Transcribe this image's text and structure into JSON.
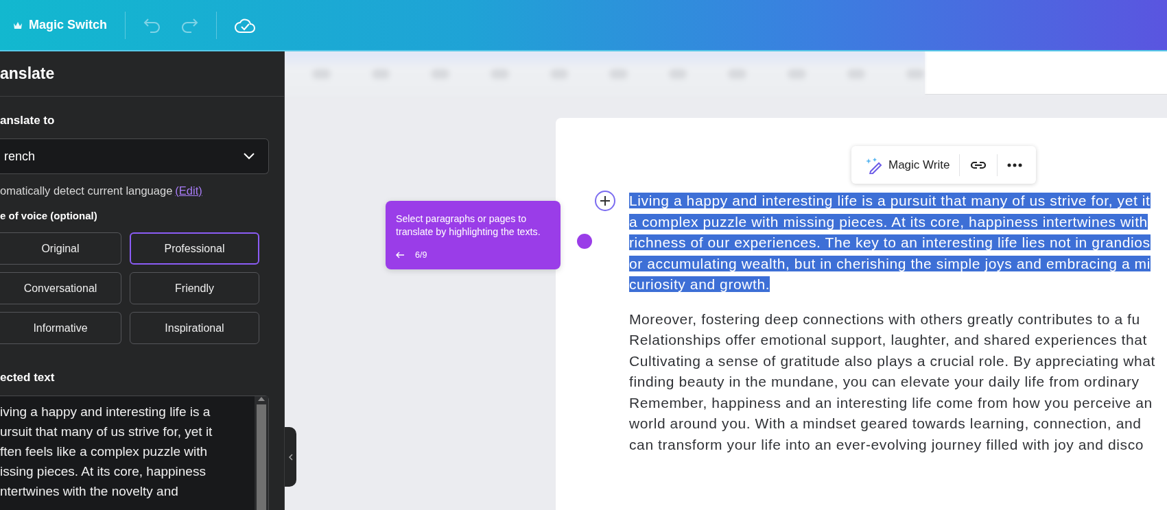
{
  "topbar": {
    "title": "Magic Switch"
  },
  "panel": {
    "title": "anslate",
    "translate_to_label": "anslate to",
    "language": "rench",
    "detect_text": "omatically detect current language",
    "edit_link": "(Edit)",
    "tone_label": "e of voice (optional)",
    "tones": [
      {
        "label": "Original",
        "selected": false
      },
      {
        "label": "Professional",
        "selected": true
      },
      {
        "label": "Conversational",
        "selected": false
      },
      {
        "label": "Friendly",
        "selected": false
      },
      {
        "label": "Informative",
        "selected": false
      },
      {
        "label": "Inspirational",
        "selected": false
      }
    ],
    "selected_text_label": "ected text",
    "selected_text_lines": [
      "iving a happy and interesting life is a",
      "ursuit that many of us strive for, yet it",
      "ften feels like a complex puzzle with",
      "issing pieces. At its core, happiness",
      "ntertwines with the novelty and"
    ]
  },
  "tooltip": {
    "text": "Select paragraphs or pages to translate by highlighting the texts.",
    "step": "6/9"
  },
  "text_toolbar": {
    "label": "Magic Write"
  },
  "document": {
    "paragraphs": [
      {
        "highlighted": true,
        "lines": [
          "Living a happy and interesting life is a pursuit that many of us strive for, yet it",
          "a complex puzzle with missing pieces. At its core, happiness intertwines with",
          "richness of our experiences. The key to an interesting life lies not in grandios",
          "or accumulating wealth, but in cherishing the simple joys and embracing a mi",
          "curiosity and growth."
        ]
      },
      {
        "highlighted": false,
        "lines": [
          "Moreover, fostering deep connections with others greatly contributes to a fu",
          "Relationships offer emotional support, laughter, and shared experiences that",
          "Cultivating a sense of gratitude also plays a crucial role. By appreciating what",
          "finding beauty in the mundane, you can elevate your daily life from ordinary",
          "Remember, happiness and an interesting life come from how you perceive an",
          "world around you. With a mindset geared towards learning, connection, and",
          "can transform your life into an ever-evolving journey filled with joy and disco"
        ]
      }
    ]
  }
}
